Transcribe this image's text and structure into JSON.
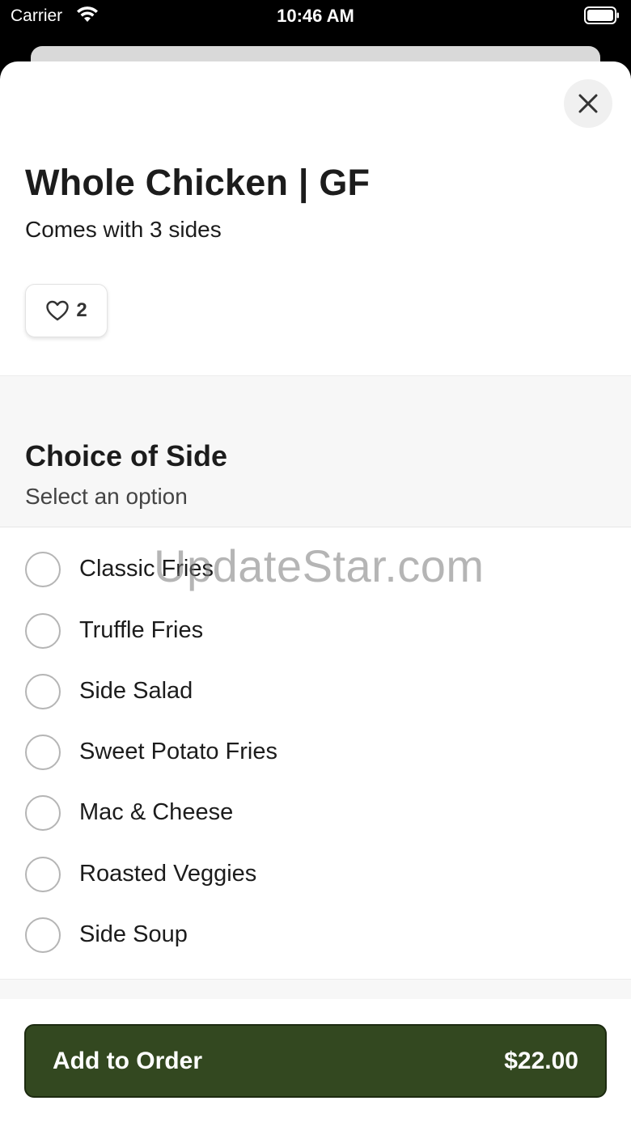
{
  "status_bar": {
    "carrier": "Carrier",
    "time": "10:46 AM",
    "icons": [
      "wifi-icon",
      "battery-icon"
    ]
  },
  "item": {
    "title": "Whole Chicken | GF",
    "description": "Comes with 3 sides",
    "likes": "2"
  },
  "section": {
    "title": "Choice of Side",
    "subtitle": "Select an option",
    "options": [
      {
        "label": "Classic Fries",
        "selected": false
      },
      {
        "label": "Truffle Fries",
        "selected": false
      },
      {
        "label": "Side Salad",
        "selected": false
      },
      {
        "label": "Sweet Potato Fries",
        "selected": false
      },
      {
        "label": "Mac & Cheese",
        "selected": false
      },
      {
        "label": "Roasted Veggies",
        "selected": false
      },
      {
        "label": "Side Soup",
        "selected": false
      }
    ]
  },
  "footer": {
    "button_label": "Add to Order",
    "price": "$22.00"
  },
  "watermark": "UpdateStar.com",
  "colors": {
    "accent": "#334820",
    "section_bg": "#f7f7f7",
    "radio_border": "#b5b5b5"
  }
}
